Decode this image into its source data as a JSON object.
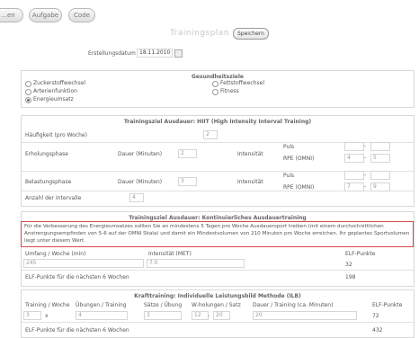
{
  "toolbar": {
    "btn1": "...en",
    "btn2": "Aufgabe",
    "btn3": "Code"
  },
  "page": {
    "title": "Trainingsplan",
    "save": "Speichern"
  },
  "date": {
    "label": "Erstellungsdatum :",
    "value": "18.11.2010"
  },
  "goals": {
    "header": "Gesundheitsziele",
    "left": [
      "Zuckerstoffwechsel",
      "Arterienfunktion",
      "Energieumsatz"
    ],
    "right": [
      "Fettstoffwechsel",
      "Fitness"
    ],
    "selected": "Energieumsatz"
  },
  "hiit": {
    "header": "Trainingsziel Ausdauer: HIIT (High Intensity Interval Training)",
    "freq_label": "Häufigkeit (pro Woche)",
    "freq_value": "2",
    "recovery_label": "Erholungsphase",
    "load_label": "Belastungsphase",
    "duration_label": "Dauer (Minuten)",
    "intensity_label": "Intensität",
    "recovery_duration": "2",
    "load_duration": "3",
    "puls_label": "Puls",
    "rpe_label": "RPE (OMNI)",
    "dash": "-",
    "recovery_rpe": [
      "4",
      "5"
    ],
    "load_rpe": [
      "7",
      "9"
    ],
    "intervals_label": "Anzahl der Intervalle",
    "intervals_value": "4"
  },
  "endurance": {
    "header": "Trainingsziel Ausdauer: Kontinuierliches Ausdauertraining",
    "note": "Für die Verbesserung des Energieumsatzes sollten Sie an mindestens 5 Tagen pro Woche Ausdauersport treiben (mit einem durchschnittlichen Anstrengungsempfinden von 5-6 auf der OMNI Skala) und damit ein Mindestvolumen von 210 Minuten pro Woche erreichen. Ihr geplantes Sportvolumen liegt unter diesem Wert.",
    "col_volume": "Umfang / Woche (min)",
    "col_intensity": "Intensität (MET)",
    "col_elf": "ELF-Punkte",
    "volume": "245",
    "intensity": "7.0",
    "elf": "32",
    "six_label": "ELF-Punkte für die nächsten 6 Wochen",
    "six_value": "198"
  },
  "strength": {
    "header": "Krafttraining: Individuelle Leistungsbild Methode (ILB)",
    "col1": "Training / Woche",
    "col2": "Übungen / Training",
    "col3": "Sätze / Übung",
    "col4": "W-holungen / Satz",
    "col5": "Dauer / Training (ca. Minuten)",
    "col6": "ELF-Punkte",
    "v1": "3",
    "x": "x",
    "v2": "4",
    "v3": "3",
    "v4a": "12",
    "dash": "-",
    "v4b": "20",
    "v5": "20",
    "elf": "72",
    "six_label": "ELF-Punkte für die nächsten 6 Wochen",
    "six_value": "432"
  }
}
